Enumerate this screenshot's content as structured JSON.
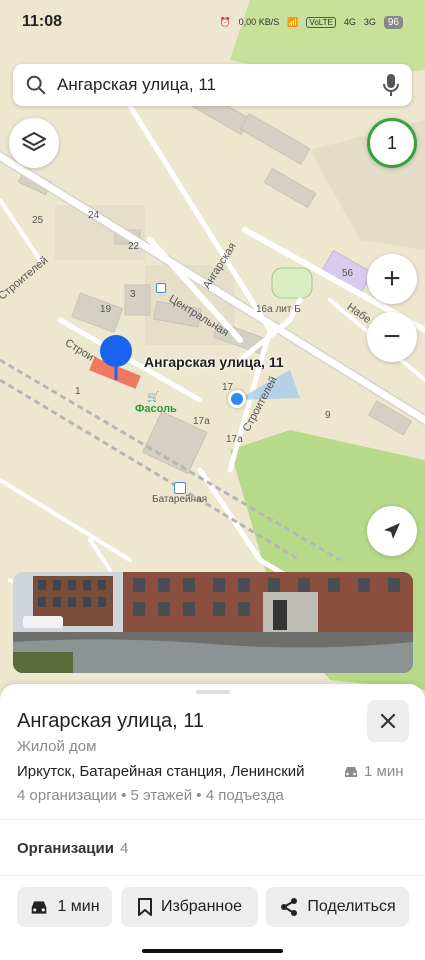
{
  "status_bar": {
    "time": "11:08",
    "net_speed": "0,00 KB/S",
    "volte": "VoLTE",
    "signal1": "4G",
    "signal2": "3G",
    "battery": "96"
  },
  "search": {
    "query": "Ангарская улица, 11",
    "search_icon": "search-icon",
    "mic_icon": "microphone-icon"
  },
  "map": {
    "layers_icon": "layers-icon",
    "counter": "1",
    "zoom_in": "+",
    "zoom_out": "−",
    "locate_icon": "navigation-arrow-icon",
    "pin_label": "Ангарская улица, 11",
    "labels": {
      "street_central": "Центральная",
      "street_angarskaya": "Ангарская",
      "street_stroiteley1": "Строителей",
      "street_stroiteley2": "Строителей",
      "street_stroiteley3": "Строителей",
      "street_nab": "Набе",
      "shop_fasol": "Фасоль",
      "stop_batareynaya": "Батарейная",
      "bld_16a": "16а лит Б",
      "bld_56": "56",
      "bld_25": "25",
      "bld_24": "24",
      "bld_22": "22",
      "bld_3": "3",
      "bld_19": "19",
      "bld_1": "1",
      "bld_17": "17",
      "bld_17a1": "17а",
      "bld_17a2": "17а",
      "bld_9": "9",
      "bld_11": "11"
    }
  },
  "card": {
    "title": "Ангарская улица, 11",
    "category": "Жилой дом",
    "address": "Иркутск, Батарейная станция, Ленинский",
    "travel_time": "1 мин",
    "meta": "4 организации • 5 этажей • 4 подъезда",
    "orgs_label": "Организации",
    "orgs_count": "4",
    "actions": {
      "route": "1 мин",
      "favorite": "Избранное",
      "share": "Поделиться"
    }
  },
  "colors": {
    "map_bg": "#ebe6d3",
    "green_area": "#b7d98a",
    "pin_blue": "#1a64f0",
    "location_blue": "#2d8cf0",
    "counter_green": "#3aa23a"
  }
}
